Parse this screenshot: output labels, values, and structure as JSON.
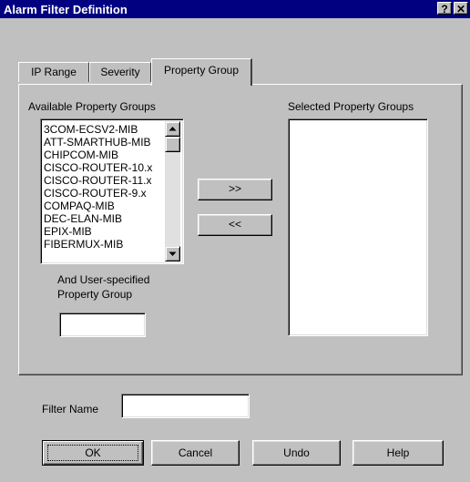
{
  "window": {
    "title": "Alarm Filter Definition",
    "help_glyph": "?",
    "close_glyph": "✕"
  },
  "tabs": [
    {
      "label": "IP Range"
    },
    {
      "label": "Severity"
    },
    {
      "label": "Property Group",
      "active": true
    }
  ],
  "available": {
    "label": "Available Property Groups",
    "items": [
      "3COM-ECSV2-MIB",
      "ATT-SMARTHUB-MIB",
      "CHIPCOM-MIB",
      "CISCO-ROUTER-10.x",
      "CISCO-ROUTER-11.x",
      "CISCO-ROUTER-9.x",
      "COMPAQ-MIB",
      "DEC-ELAN-MIB",
      "EPIX-MIB",
      "FIBERMUX-MIB"
    ]
  },
  "selected": {
    "label": "Selected Property Groups",
    "items": []
  },
  "move_buttons": {
    "add": ">>",
    "remove": "<<"
  },
  "user_group": {
    "label_line1": "And User-specified",
    "label_line2": "Property Group",
    "value": ""
  },
  "filter_name": {
    "label": "Filter Name",
    "value": ""
  },
  "buttons": {
    "ok": "OK",
    "cancel": "Cancel",
    "undo": "Undo",
    "help": "Help"
  },
  "colors": {
    "titlebar": "#000080",
    "face": "#c0c0c0"
  }
}
